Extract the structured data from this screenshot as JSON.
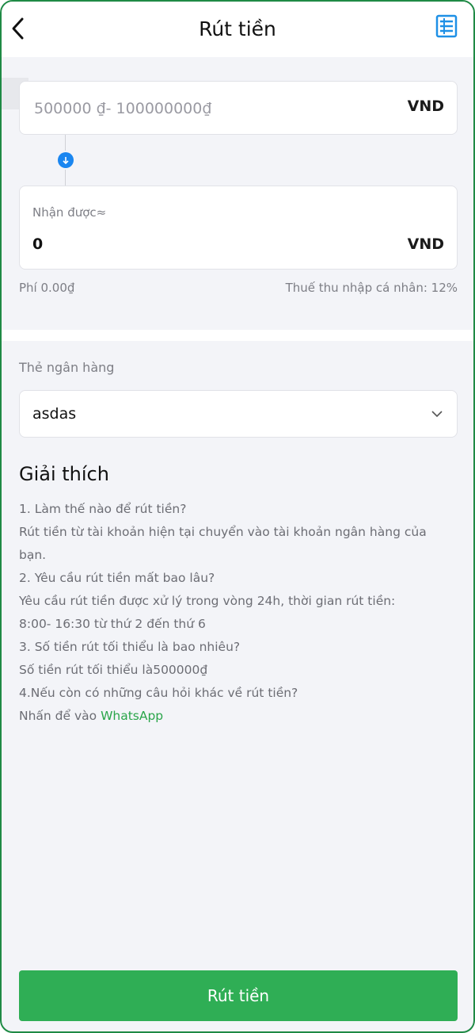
{
  "header": {
    "title": "Rút tiền"
  },
  "amount": {
    "placeholder": "500000 ₫- 100000000₫",
    "unit": "VND"
  },
  "receive": {
    "label": "Nhận được≈",
    "value": "0",
    "unit": "VND"
  },
  "fee_text": "Phí 0.00₫",
  "tax_text": "Thuế thu nhập cá nhân: 12%",
  "bank": {
    "label": "Thẻ ngân hàng",
    "selected": "asdas"
  },
  "explain": {
    "title": "Giải thích",
    "lines": [
      "1. Làm thế nào để rút tiền?",
      "Rút tiền từ tài khoản hiện tại chuyển vào tài khoản ngân hàng của",
      "bạn.",
      "2. Yêu cầu rút tiền mất bao lâu?",
      "Yêu cầu rút tiền được xử lý trong vòng 24h, thời gian rút tiền:",
      "8:00- 16:30 từ thứ 2 đến thứ 6",
      "3. Số tiền rút tối thiểu là bao nhiêu?",
      "Số tiền rút tối thiểu là500000₫",
      "4.Nếu còn có những câu hỏi khác về rút tiền?"
    ],
    "contact_prefix": "Nhấn để vào ",
    "contact_link": "WhatsApp"
  },
  "submit_label": "Rút tiền",
  "colors": {
    "accent": "#2fae55",
    "link": "#2aa54a",
    "arrow": "#1a86f0",
    "history_icon": "#1e90e6"
  },
  "icons": {
    "back": "chevron-left-icon",
    "history": "list-document-icon",
    "arrow": "arrow-down-icon",
    "dropdown": "chevron-down-icon"
  }
}
